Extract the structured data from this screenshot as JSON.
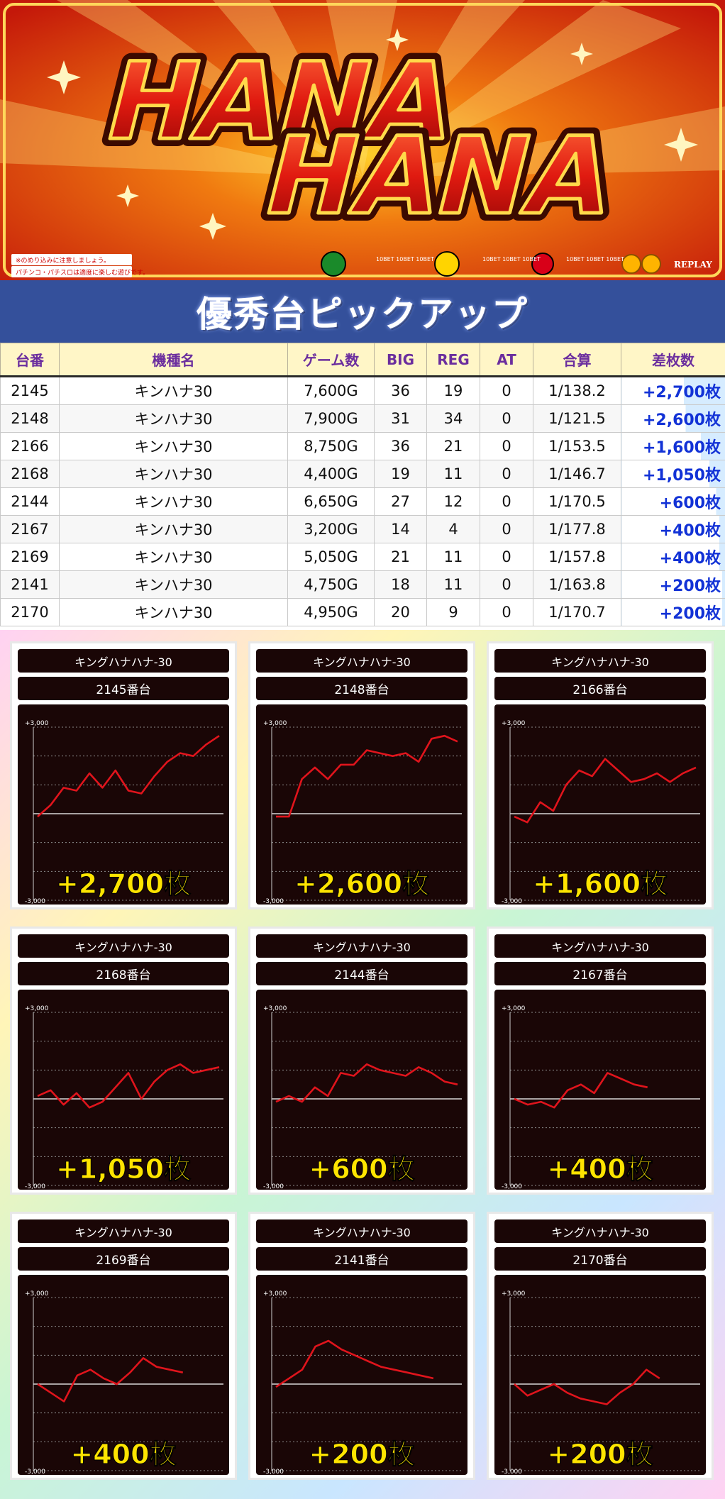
{
  "banner": {
    "logo_line1": "HANA",
    "logo_line2": "HANA",
    "notice_line1": "※のめり込みに注意しましょう。",
    "notice_line2": "パチンコ・パチスロは適度に楽しむ遊びです。",
    "reel_labels": [
      "10BET 10BET 10BET",
      "10BET 10BET 10BET",
      "10BET 10BET 10BET"
    ],
    "replay_label": "REPLAY"
  },
  "section_title": "優秀台ピックアップ",
  "table": {
    "headers": [
      "台番",
      "機種名",
      "ゲーム数",
      "BIG",
      "REG",
      "AT",
      "合算",
      "差枚数"
    ],
    "rows": [
      [
        "2145",
        "キンハナ30",
        "7,600G",
        "36",
        "19",
        "0",
        "1/138.2",
        "+2,700枚"
      ],
      [
        "2148",
        "キンハナ30",
        "7,900G",
        "31",
        "34",
        "0",
        "1/121.5",
        "+2,600枚"
      ],
      [
        "2166",
        "キンハナ30",
        "8,750G",
        "36",
        "21",
        "0",
        "1/153.5",
        "+1,600枚"
      ],
      [
        "2168",
        "キンハナ30",
        "4,400G",
        "19",
        "11",
        "0",
        "1/146.7",
        "+1,050枚"
      ],
      [
        "2144",
        "キンハナ30",
        "6,650G",
        "27",
        "12",
        "0",
        "1/170.5",
        "+600枚"
      ],
      [
        "2167",
        "キンハナ30",
        "3,200G",
        "14",
        "4",
        "0",
        "1/177.8",
        "+400枚"
      ],
      [
        "2169",
        "キンハナ30",
        "5,050G",
        "21",
        "11",
        "0",
        "1/157.8",
        "+400枚"
      ],
      [
        "2141",
        "キンハナ30",
        "4,750G",
        "18",
        "11",
        "0",
        "1/163.8",
        "+200枚"
      ],
      [
        "2170",
        "キンハナ30",
        "4,950G",
        "20",
        "9",
        "0",
        "1/170.7",
        "+200枚"
      ]
    ],
    "diff_values": [
      2700,
      2600,
      1600,
      1050,
      600,
      400,
      400,
      200,
      200
    ],
    "diff_scale_max": 2700
  },
  "colors": {
    "banner_red": "#d8200c",
    "header_blue": "#34509b",
    "table_header_bg": "#fff6c7",
    "table_header_text": "#6b2e9e",
    "diff_text": "#1232d6",
    "chart_bg": "#1a0606",
    "chart_line": "#e0141c",
    "result_text": "#ffe400"
  },
  "chart_data": [
    {
      "type": "line",
      "title": "キングハナハナ-30",
      "subtitle": "2145番台",
      "result_label": "+2,700枚",
      "ytick_labels": [
        "+3,000",
        "-3,000"
      ],
      "ylim": [
        -3000,
        3000
      ],
      "grid": true,
      "y": [
        -100,
        300,
        900,
        800,
        1400,
        900,
        1500,
        800,
        700,
        1300,
        1800,
        2100,
        2000,
        2400,
        2700
      ]
    },
    {
      "type": "line",
      "title": "キングハナハナ-30",
      "subtitle": "2148番台",
      "result_label": "+2,600枚",
      "ytick_labels": [
        "+3,000",
        "-3,000"
      ],
      "ylim": [
        -3000,
        3000
      ],
      "grid": true,
      "y": [
        -100,
        -100,
        1200,
        1600,
        1200,
        1700,
        1700,
        2200,
        2100,
        2000,
        2100,
        1800,
        2600,
        2700,
        2500
      ]
    },
    {
      "type": "line",
      "title": "キングハナハナ-30",
      "subtitle": "2166番台",
      "result_label": "+1,600枚",
      "ytick_labels": [
        "+3,000",
        "-3,000"
      ],
      "ylim": [
        -3000,
        3000
      ],
      "grid": true,
      "y": [
        -100,
        -300,
        400,
        100,
        1000,
        1500,
        1300,
        1900,
        1500,
        1100,
        1200,
        1400,
        1100,
        1400,
        1600
      ]
    },
    {
      "type": "line",
      "title": "キングハナハナ-30",
      "subtitle": "2168番台",
      "result_label": "+1,050枚",
      "ytick_labels": [
        "+3,000",
        "-3,000"
      ],
      "ylim": [
        -3000,
        3000
      ],
      "grid": true,
      "y": [
        100,
        300,
        -200,
        200,
        -300,
        -100,
        400,
        900,
        0,
        600,
        1000,
        1200,
        900,
        1000,
        1100
      ]
    },
    {
      "type": "line",
      "title": "キングハナハナ-30",
      "subtitle": "2144番台",
      "result_label": "+600枚",
      "ytick_labels": [
        "+3,000",
        "-3,000"
      ],
      "ylim": [
        -3000,
        3000
      ],
      "grid": true,
      "y": [
        -100,
        100,
        -100,
        400,
        100,
        900,
        800,
        1200,
        1000,
        900,
        800,
        1100,
        900,
        600,
        500
      ]
    },
    {
      "type": "line",
      "title": "キングハナハナ-30",
      "subtitle": "2167番台",
      "result_label": "+400枚",
      "ytick_labels": [
        "+3,000",
        "-3,000"
      ],
      "ylim": [
        -3000,
        3000
      ],
      "grid": true,
      "y": [
        0,
        -200,
        -100,
        -300,
        300,
        500,
        200,
        900,
        700,
        500,
        400
      ]
    },
    {
      "type": "line",
      "title": "キングハナハナ-30",
      "subtitle": "2169番台",
      "result_label": "+400枚",
      "ytick_labels": [
        "+3,000",
        "-3,000"
      ],
      "ylim": [
        -3000,
        3000
      ],
      "grid": true,
      "y": [
        0,
        -300,
        -600,
        300,
        500,
        200,
        0,
        400,
        900,
        600,
        500,
        400
      ]
    },
    {
      "type": "line",
      "title": "キングハナハナ-30",
      "subtitle": "2141番台",
      "result_label": "+200枚",
      "ytick_labels": [
        "+3,000",
        "-3,000"
      ],
      "ylim": [
        -3000,
        3000
      ],
      "grid": true,
      "y": [
        -100,
        200,
        500,
        1300,
        1500,
        1200,
        1000,
        800,
        600,
        500,
        400,
        300,
        200
      ]
    },
    {
      "type": "line",
      "title": "キングハナハナ-30",
      "subtitle": "2170番台",
      "result_label": "+200枚",
      "ytick_labels": [
        "+3,000",
        "-3,000"
      ],
      "ylim": [
        -3000,
        3000
      ],
      "grid": true,
      "y": [
        0,
        -400,
        -200,
        0,
        -300,
        -500,
        -600,
        -700,
        -300,
        0,
        500,
        200
      ]
    }
  ]
}
